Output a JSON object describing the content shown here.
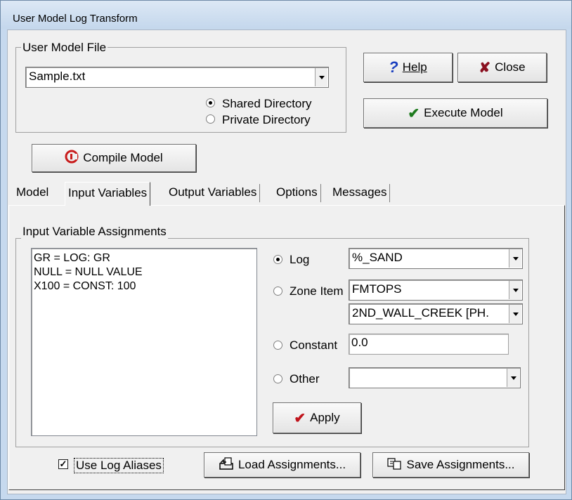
{
  "window": {
    "title": "User Model Log Transform"
  },
  "user_model_file": {
    "group_label": "User Model File",
    "file_value": "Sample.txt",
    "radio_options": [
      {
        "label": "Shared Directory",
        "checked": true
      },
      {
        "label": "Private Directory",
        "checked": false
      }
    ]
  },
  "buttons": {
    "help": "Help",
    "close": "Close",
    "execute": "Execute Model",
    "compile": "Compile Model",
    "apply": "Apply",
    "load": "Load Assignments...",
    "save": "Save Assignments..."
  },
  "tabs": [
    {
      "label": "Model",
      "active": false
    },
    {
      "label": "Input Variables",
      "active": true
    },
    {
      "label": "Output Variables",
      "active": false
    },
    {
      "label": "Options",
      "active": false
    },
    {
      "label": "Messages",
      "active": false
    }
  ],
  "input_assignments": {
    "group_label": "Input Variable Assignments",
    "list_items": [
      "GR = LOG: GR",
      "NULL = NULL VALUE",
      "X100 = CONST: 100"
    ],
    "options": {
      "log": {
        "label": "Log",
        "checked": true,
        "value": "%_SAND"
      },
      "zone_item": {
        "label": "Zone Item",
        "checked": false,
        "value": "FMTOPS",
        "value2": "2ND_WALL_CREEK  [PH."
      },
      "constant": {
        "label": "Constant",
        "checked": false,
        "value": "0.0"
      },
      "other": {
        "label": "Other",
        "checked": false,
        "value": ""
      }
    }
  },
  "use_log_aliases": {
    "label": "Use Log Aliases",
    "checked": true,
    "mark": "✓"
  },
  "icons": {
    "help": "question-icon",
    "close": "x-icon",
    "execute": "checkmark-icon",
    "compile": "compile-icon",
    "apply": "checkmark-icon",
    "load": "load-icon",
    "save": "save-icon"
  },
  "colors": {
    "help_icon": "#1a3fbf",
    "close_icon": "#8a1020",
    "check_icon": "#1d7a1d",
    "apply_icon": "#c0141c",
    "compile_icon": "#c81c1c"
  }
}
